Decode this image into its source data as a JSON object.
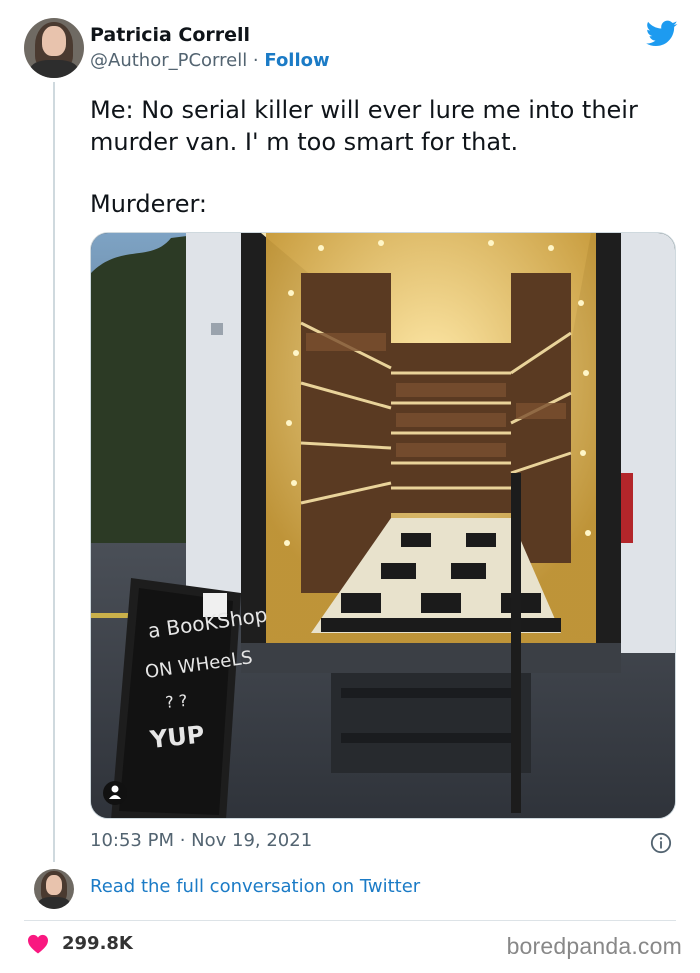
{
  "author": {
    "name": "Patricia Correll",
    "handle": "@Author_PCorrell",
    "separator": " · ",
    "follow_label": "Follow"
  },
  "tweet": {
    "line1": "Me: No serial killer will ever lure me into their murder van. I' m too smart for that.",
    "line2": "Murderer:",
    "timestamp": "10:53 PM · Nov 19, 2021"
  },
  "media": {
    "sign": {
      "line1": "a BooKShop",
      "line2": "ON WHeeLS",
      "line3": "? ?",
      "line4": "YUP"
    }
  },
  "footer": {
    "read_more": "Read the full conversation on Twitter",
    "likes": "299.8K",
    "watermark": "boredpanda.com"
  },
  "icons": {
    "twitter": "twitter-bird-icon",
    "info": "info-icon",
    "heart": "heart-icon",
    "person": "person-icon"
  },
  "colors": {
    "link": "#1b7bc6",
    "twitter_blue": "#1d9bf0",
    "heart": "#f91880",
    "secondary_text": "#536471"
  }
}
